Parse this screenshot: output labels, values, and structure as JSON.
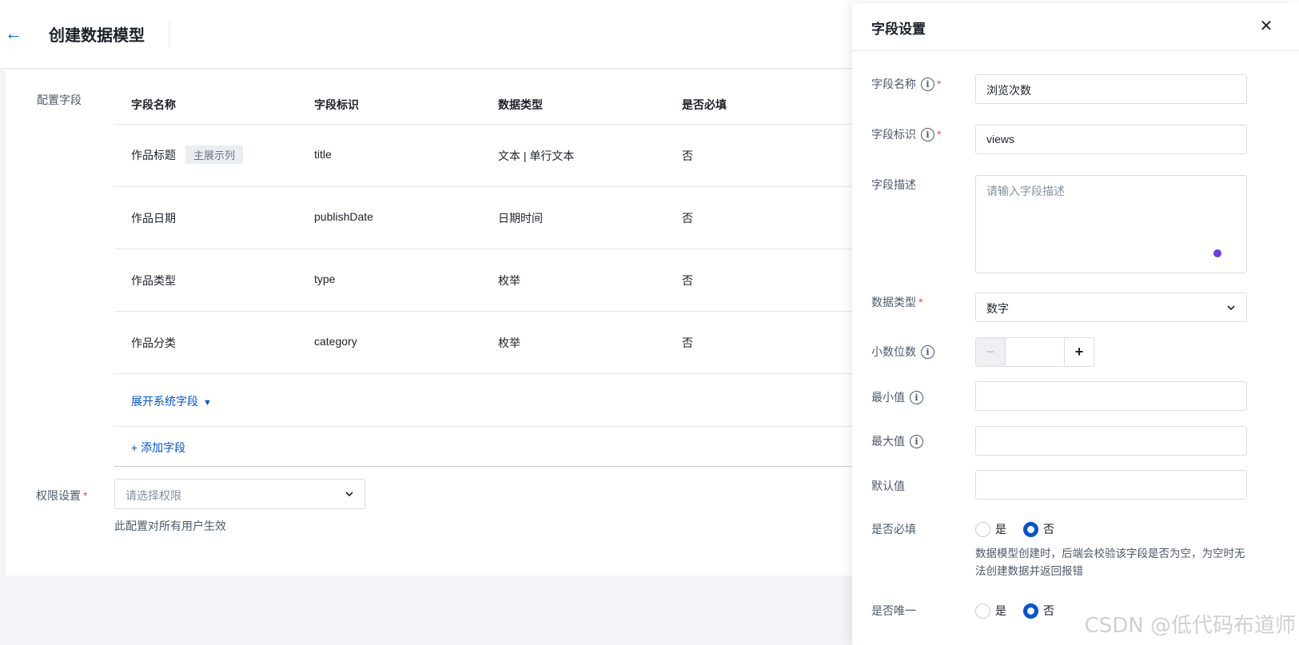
{
  "header": {
    "title": "创建数据模型"
  },
  "main": {
    "section_label": "配置字段",
    "columns": [
      "字段名称",
      "字段标识",
      "数据类型",
      "是否必填"
    ],
    "rows": [
      {
        "name": "作品标题",
        "tag": "主展示列",
        "key": "title",
        "type": "文本 | 单行文本",
        "required": "否"
      },
      {
        "name": "作品日期",
        "key": "publishDate",
        "type": "日期时间",
        "required": "否"
      },
      {
        "name": "作品类型",
        "key": "type",
        "type": "枚举",
        "required": "否"
      },
      {
        "name": "作品分类",
        "key": "category",
        "type": "枚举",
        "required": "否"
      }
    ],
    "expand_label": "展开系统字段",
    "add_label": "+ 添加字段",
    "permission": {
      "label": "权限设置",
      "placeholder": "请选择权限",
      "hint": "此配置对所有用户生效"
    }
  },
  "drawer": {
    "title": "字段设置",
    "field_name": {
      "label": "字段名称",
      "value": "浏览次数"
    },
    "field_key": {
      "label": "字段标识",
      "value": "views"
    },
    "field_desc": {
      "label": "字段描述",
      "placeholder": "请输入字段描述"
    },
    "data_type": {
      "label": "数据类型",
      "value": "数字"
    },
    "decimals": {
      "label": "小数位数",
      "value": ""
    },
    "min_value": {
      "label": "最小值",
      "value": ""
    },
    "max_value": {
      "label": "最大值",
      "value": ""
    },
    "default_value": {
      "label": "默认值",
      "value": ""
    },
    "required": {
      "label": "是否必填",
      "options": [
        "是",
        "否"
      ],
      "selected": "否",
      "help": "数据模型创建时，后端会校验该字段是否为空，为空时无法创建数据并返回报错"
    },
    "unique": {
      "label": "是否唯一",
      "options": [
        "是",
        "否"
      ],
      "selected": "否"
    }
  },
  "watermark": "CSDN @低代码布道师",
  "colors": {
    "primary": "#0052d9",
    "required": "#e34d59",
    "accent_dot": "#6a3de8"
  }
}
